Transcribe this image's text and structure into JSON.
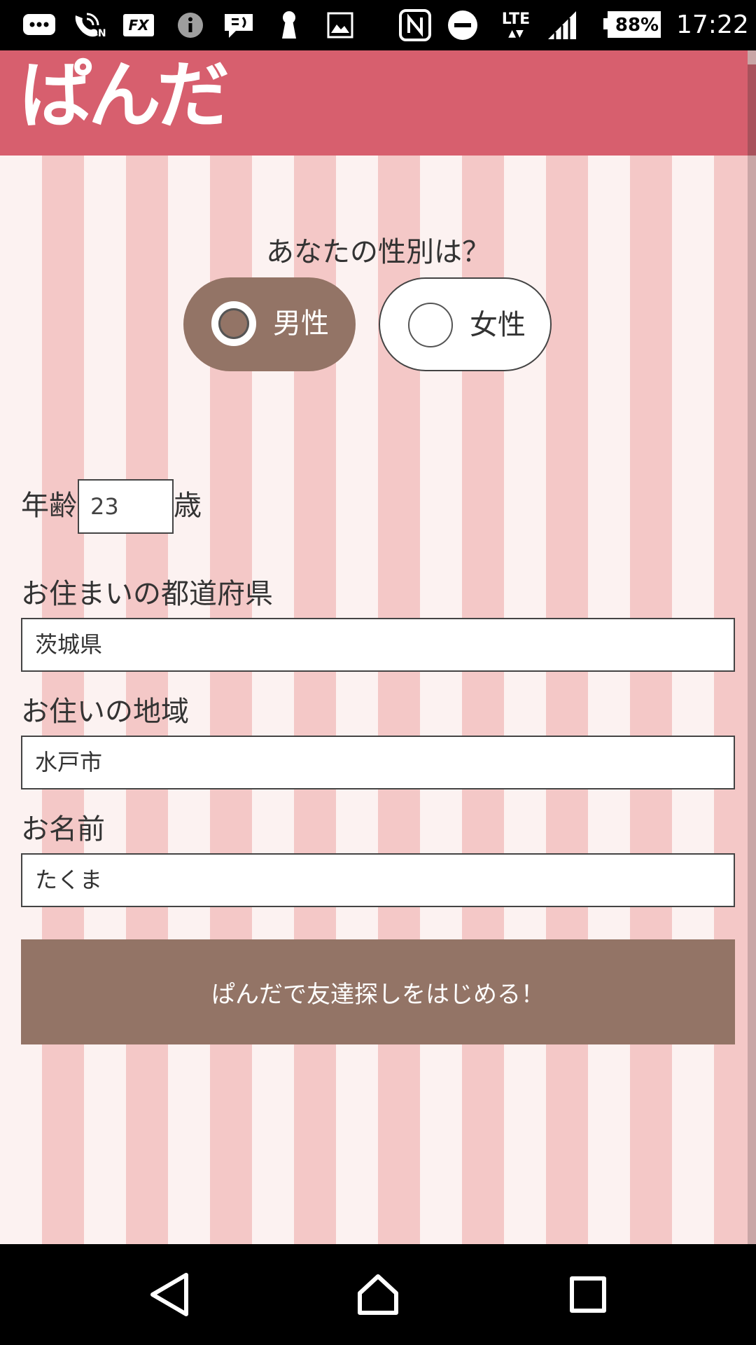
{
  "status_bar": {
    "battery": "88%",
    "time": "17:22",
    "network": "LTE",
    "icons": [
      "chat-bubble-icon",
      "wifi-calling-on-icon",
      "fx-app-icon",
      "info-icon",
      "message-icon",
      "keyhole-icon",
      "image-icon",
      "nfc-icon",
      "do-not-disturb-icon",
      "lte-data-icon",
      "signal-icon",
      "battery-icon"
    ],
    "wifi_call_badge": "ON",
    "fx_label": "FX"
  },
  "header": {
    "logo": "ぱんだ"
  },
  "form": {
    "gender_question": "あなたの性別は？",
    "gender_options": [
      {
        "label": "男性",
        "selected": true
      },
      {
        "label": "女性",
        "selected": false
      }
    ],
    "age_label": "年齢",
    "age_value": "23",
    "age_unit": "歳",
    "prefecture_label": "お住まいの都道府県",
    "prefecture_value": "茨城県",
    "area_label": "お住いの地域",
    "area_value": "水戸市",
    "name_label": "お名前",
    "name_value": "たくま",
    "start_button": "ぱんだで友達探しをはじめる！"
  },
  "colors": {
    "header": "#d75f6e",
    "stripe_light": "#fcf2f1",
    "stripe_dark": "#f4c8c7",
    "accent_brown": "#937466"
  },
  "nav_bar": {
    "icons": [
      "back-icon",
      "home-icon",
      "recent-apps-icon"
    ]
  }
}
